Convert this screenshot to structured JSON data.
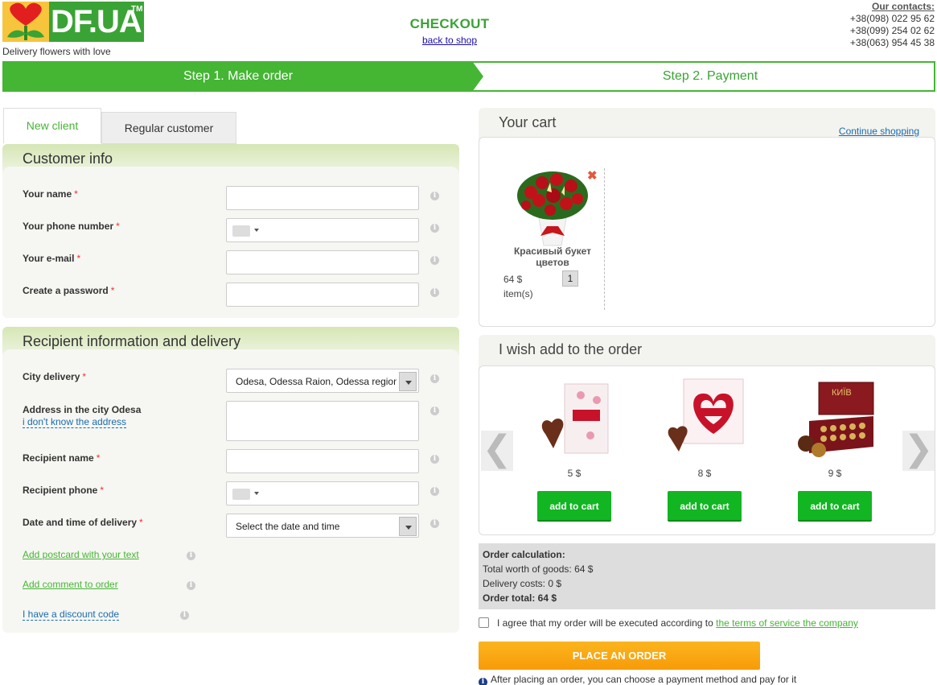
{
  "header": {
    "logo_text": "DF.UA",
    "logo_tm": "TM",
    "tagline": "Delivery flowers with love",
    "title": "CHECKOUT",
    "back_link": "back to shop",
    "contacts_title": "Our contacts:",
    "phones": [
      "+38(098) 022 95 62",
      "+38(099) 254 02 62",
      "+38(063) 954 45 38"
    ]
  },
  "steps": {
    "step1": "Step 1. Make order",
    "step2": "Step 2. Payment"
  },
  "tabs": {
    "new_client": "New client",
    "regular": "Regular customer"
  },
  "customer_info": {
    "title": "Customer info",
    "fields": {
      "name": "Your name",
      "phone": "Your phone number",
      "email": "Your e-mail",
      "password": "Create a password"
    },
    "required_mark": "*"
  },
  "recipient": {
    "title": "Recipient information and delivery",
    "city_label": "City delivery",
    "city_value": "Odesa, Odessa Raion, Odessa region",
    "address_label": "Address in the city Odesa",
    "address_unknown_link": "i don't know the address",
    "recipient_name_label": "Recipient name",
    "recipient_phone_label": "Recipient phone",
    "datetime_label": "Date and time of delivery",
    "datetime_value": "Select the date and time",
    "postcard_link": "Add postcard with your text",
    "comment_link": "Add comment to order",
    "discount_link": "I have a discount code"
  },
  "cart": {
    "title": "Your cart",
    "continue_link": "Continue shopping",
    "remove_icon": "✖",
    "item": {
      "name": "Красивый букет цветов",
      "price": "64 $",
      "unit": "item(s)",
      "qty": "1"
    }
  },
  "upsell": {
    "title": "I wish add to the order",
    "prev": "❮",
    "next": "❯",
    "items": [
      {
        "price": "5 $",
        "button": "add to cart"
      },
      {
        "price": "8 $",
        "button": "add to cart"
      },
      {
        "price": "9 $",
        "button": "add to cart",
        "box_text": "КИЇВ"
      }
    ]
  },
  "calc": {
    "title": "Order calculation:",
    "goods": "Total worth of goods: 64 $",
    "delivery": "Delivery costs: 0 $",
    "total": "Order total: 64 $"
  },
  "agreement": {
    "text": "I agree that my order will be executed according to ",
    "link": "the terms of service the company"
  },
  "place_order": "PLACE AN ORDER",
  "after_note": "After placing an order, you can choose a payment method and pay for it",
  "info_glyph": "i",
  "colors": {
    "brand_green": "#45b534",
    "button_green": "#12b522",
    "orange": "#f79b08",
    "link_blue": "#1a6ab1"
  }
}
